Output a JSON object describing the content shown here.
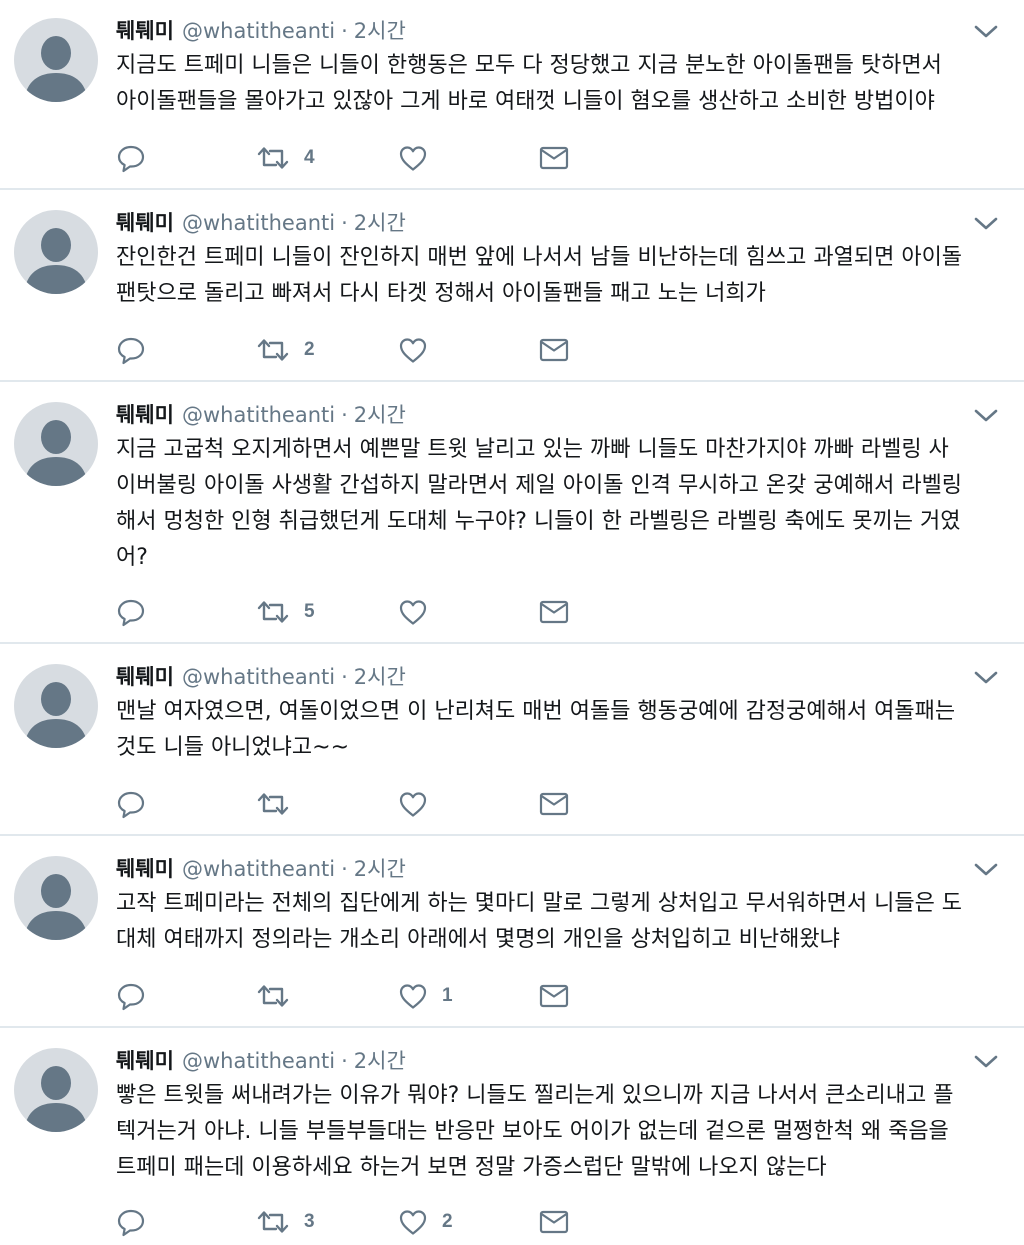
{
  "colors": {
    "accent_gray": "#657786",
    "text": "#14171a",
    "divider": "#e1e8ed",
    "avatar_bg": "#d7dce1",
    "avatar_fg": "#657786"
  },
  "icons": {
    "reply": "speech-bubble-icon",
    "retweet": "retweet-arrows-icon",
    "like": "heart-icon",
    "dm": "envelope-icon",
    "caret": "chevron-down-icon",
    "avatar": "default-profile-icon"
  },
  "tweets": [
    {
      "name": "퉤퉤미",
      "handle": "@whatitheanti",
      "dot": "·",
      "time": "2시간",
      "lines": [
        "지금도 트페미 니들은 니들이 한행동은 모두 다 정당했고 지금 분노한 아이돌팬들 탓하면서",
        "아이돌팬들을 몰아가고 있잖아 그게 바로 여태껏 니들이 혐오를 생산하고 소비한 방법이야"
      ],
      "replies": "",
      "retweets": "4",
      "likes": ""
    },
    {
      "name": "퉤퉤미",
      "handle": "@whatitheanti",
      "dot": "·",
      "time": "2시간",
      "lines": [
        "잔인한건 트페미 니들이 잔인하지 매번 앞에 나서서 남들 비난하는데 힘쓰고 과열되면 아이돌",
        "팬탓으로 돌리고 빠져서 다시 타겟 정해서 아이돌팬들 패고 노는 너희가"
      ],
      "replies": "",
      "retweets": "2",
      "likes": ""
    },
    {
      "name": "퉤퉤미",
      "handle": "@whatitheanti",
      "dot": "·",
      "time": "2시간",
      "lines": [
        "지금 고굽척 오지게하면서 예쁜말 트윗 날리고 있는 까빠 니들도 마찬가지야 까빠 라벨링 사",
        "이버불링 아이돌 사생활 간섭하지 말라면서 제일 아이돌 인격 무시하고 온갖 궁예해서 라벨링",
        "해서 멍청한 인형 취급했던게 도대체 누구야? 니들이 한 라벨링은 라벨링 축에도 못끼는 거였",
        "어?"
      ],
      "replies": "",
      "retweets": "5",
      "likes": ""
    },
    {
      "name": "퉤퉤미",
      "handle": "@whatitheanti",
      "dot": "·",
      "time": "2시간",
      "lines": [
        "맨날 여자였으면, 여돌이었으면 이 난리쳐도 매번 여돌들 행동궁예에 감정궁예해서 여돌패는",
        "것도 니들 아니었냐고~~"
      ],
      "replies": "",
      "retweets": "",
      "likes": ""
    },
    {
      "name": "퉤퉤미",
      "handle": "@whatitheanti",
      "dot": "·",
      "time": "2시간",
      "lines": [
        "고작 트페미라는 전체의 집단에게 하는 몇마디 말로 그렇게 상처입고 무서워하면서 니들은 도",
        "대체 여태까지 정의라는 개소리 아래에서 몇명의 개인을 상처입히고 비난해왔냐"
      ],
      "replies": "",
      "retweets": "",
      "likes": "1"
    },
    {
      "name": "퉤퉤미",
      "handle": "@whatitheanti",
      "dot": "·",
      "time": "2시간",
      "lines": [
        "빻은 트윗들 써내려가는 이유가 뭐야? 니들도 찔리는게 있으니까 지금 나서서 큰소리내고 플",
        "텍거는거 아냐. 니들 부들부들대는 반응만 보아도 어이가 없는데 겉으론 멀쩡한척 왜 죽음을",
        "트페미 패는데 이용하세요 하는거 보면 정말 가증스럽단 말밖에 나오지 않는다"
      ],
      "replies": "",
      "retweets": "3",
      "likes": "2"
    }
  ]
}
